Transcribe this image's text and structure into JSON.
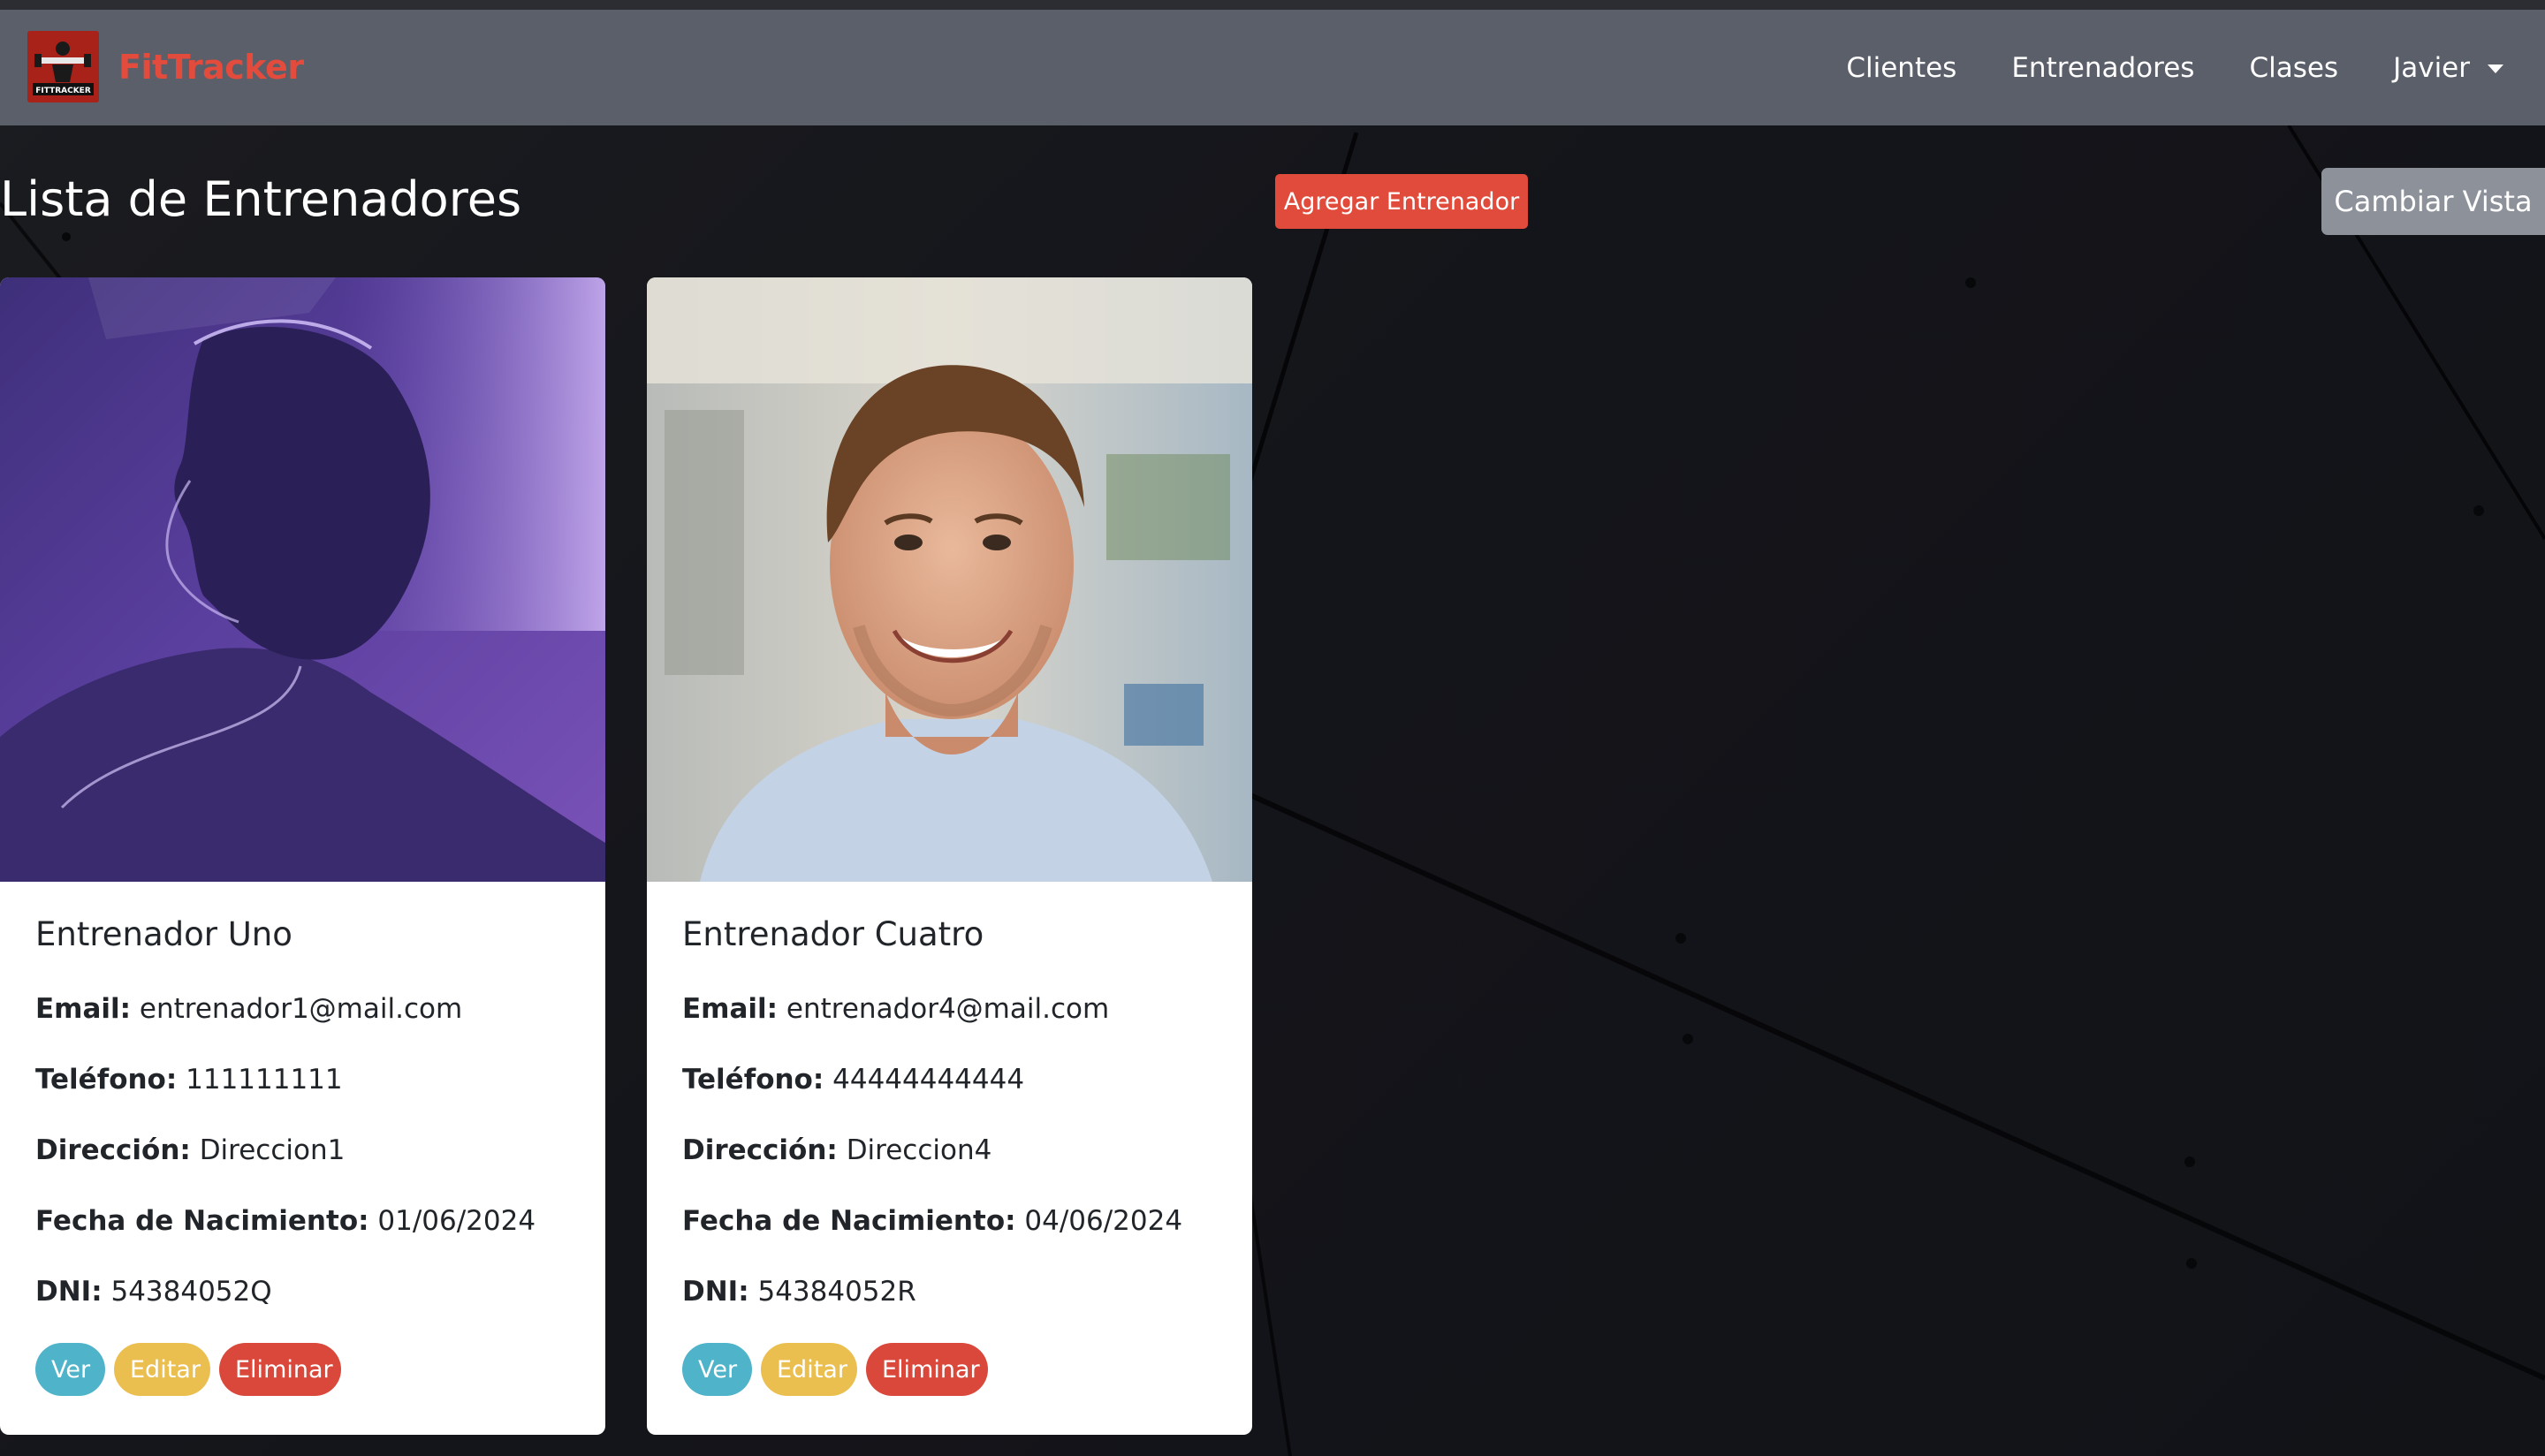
{
  "app": {
    "brand": "FitTracker",
    "logo_text": "FITTRACKER",
    "brand_color": "#e34b3c"
  },
  "nav": {
    "items": [
      {
        "label": "Clientes"
      },
      {
        "label": "Entrenadores"
      },
      {
        "label": "Clases"
      }
    ],
    "user": "Javier"
  },
  "page": {
    "title": "Lista de Entrenadores",
    "add_button": "Agregar Entrenador",
    "toggle_view_button": "Cambiar Vista"
  },
  "labels": {
    "email": "Email:",
    "phone": "Teléfono:",
    "address": "Dirección:",
    "birth_date": "Fecha de Nacimiento:",
    "dni": "DNI:"
  },
  "actions": {
    "view": "Ver",
    "edit": "Editar",
    "delete": "Eliminar"
  },
  "trainers": [
    {
      "name": "Entrenador Uno",
      "email": "entrenador1@mail.com",
      "phone": "111111111",
      "address": "Direccion1",
      "birth_date": "01/06/2024",
      "dni": "54384052Q",
      "photo": "purple-tinted-profile-photo"
    },
    {
      "name": "Entrenador Cuatro",
      "email": "entrenador4@mail.com",
      "phone": "44444444444",
      "address": "Direccion4",
      "birth_date": "04/06/2024",
      "dni": "54384052R",
      "photo": "smiling-man-office-photo"
    }
  ],
  "colors": {
    "navbar": "#5b5f69",
    "add_button": "#e04b3b",
    "view_pill": "#4fb3c9",
    "edit_pill": "#ebbf4f",
    "delete_pill": "#d9483a",
    "toggle_button": "#8d919a"
  }
}
